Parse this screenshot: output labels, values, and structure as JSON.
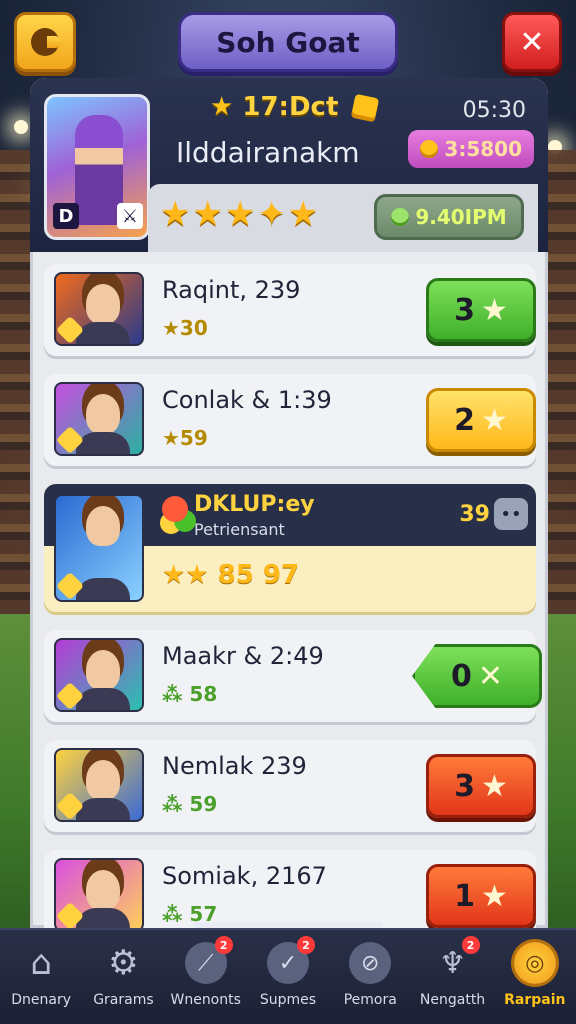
{
  "header": {
    "title": "Soh Goat",
    "settings_icon": "✕"
  },
  "profile": {
    "rank_label": "17:Dct",
    "time": "05:30",
    "name": "Ilddairanakm",
    "coins": "3:5800",
    "stars": "★★★✦★",
    "xp": "9.40IPM"
  },
  "list": [
    {
      "title": "Raqint, 239",
      "sub": "★30",
      "action_value": "3",
      "action_color": "green",
      "sub_color": "gold"
    },
    {
      "title": "Conlak & 1:39",
      "sub": "★59",
      "action_value": "2",
      "action_color": "yellow",
      "sub_color": "gold"
    },
    {
      "highlighted": true,
      "title": "DKLUP:ey",
      "subtitle": "Petriensant",
      "score": "39",
      "more_label": "••",
      "stars_line": "★★ 85 97"
    },
    {
      "title": "Maakr & 2:49",
      "sub": "⁂ 58",
      "action_value": "0",
      "action_icon": "✕",
      "action_color": "greenarrow",
      "sub_color": "green"
    },
    {
      "title": "Nemlak 239",
      "sub": "⁂ 59",
      "action_value": "3",
      "action_color": "red",
      "sub_color": "green"
    },
    {
      "title": "Somiak, 2167",
      "sub": "⁂ 57",
      "action_value": "1",
      "action_color": "red",
      "sub_color": "green"
    }
  ],
  "nav": [
    {
      "label": "Dnenary",
      "icon": "house-icon",
      "glyph": "⌂"
    },
    {
      "label": "Grarams",
      "icon": "gear-icon",
      "glyph": "⚙"
    },
    {
      "label": "Wnenonts",
      "icon": "wrench-icon",
      "glyph": "⟋",
      "badge": "2"
    },
    {
      "label": "Supmes",
      "icon": "check-icon",
      "glyph": "✓",
      "badge": "2"
    },
    {
      "label": "Pemora",
      "icon": "no-run-icon",
      "glyph": "⊘"
    },
    {
      "label": "Nengatth",
      "icon": "trophy-icon",
      "glyph": "♆",
      "badge": "2"
    },
    {
      "label": "Rarpain",
      "icon": "gold-coin-icon",
      "glyph": "◎",
      "active": true
    }
  ]
}
